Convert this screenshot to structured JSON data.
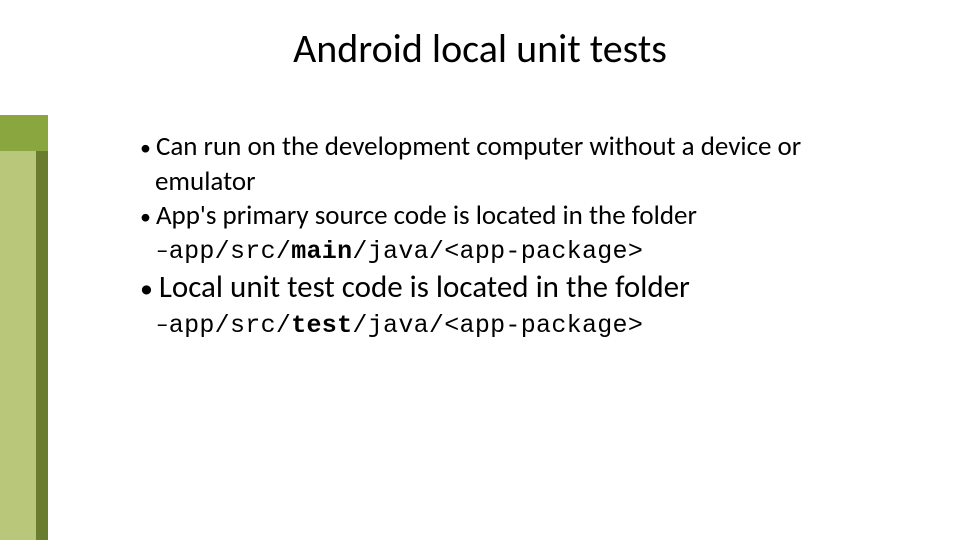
{
  "slide": {
    "title": "Android local unit tests",
    "bullets": {
      "b1": "Can run on the development computer without a device or emulator",
      "b2": "App's primary source code is located in the folder",
      "b3": "Local unit test code is located in the folder"
    },
    "paths": {
      "p1_pre": "app/src/",
      "p1_bold": "main",
      "p1_post": "/java/<app-package>",
      "p2_pre": "app/src/",
      "p2_bold": "test",
      "p2_post": "/java/<app-package>"
    },
    "accent_colors": {
      "light": "#b8c77a",
      "dark": "#6a7d2e",
      "cap": "#8aa63f"
    }
  }
}
